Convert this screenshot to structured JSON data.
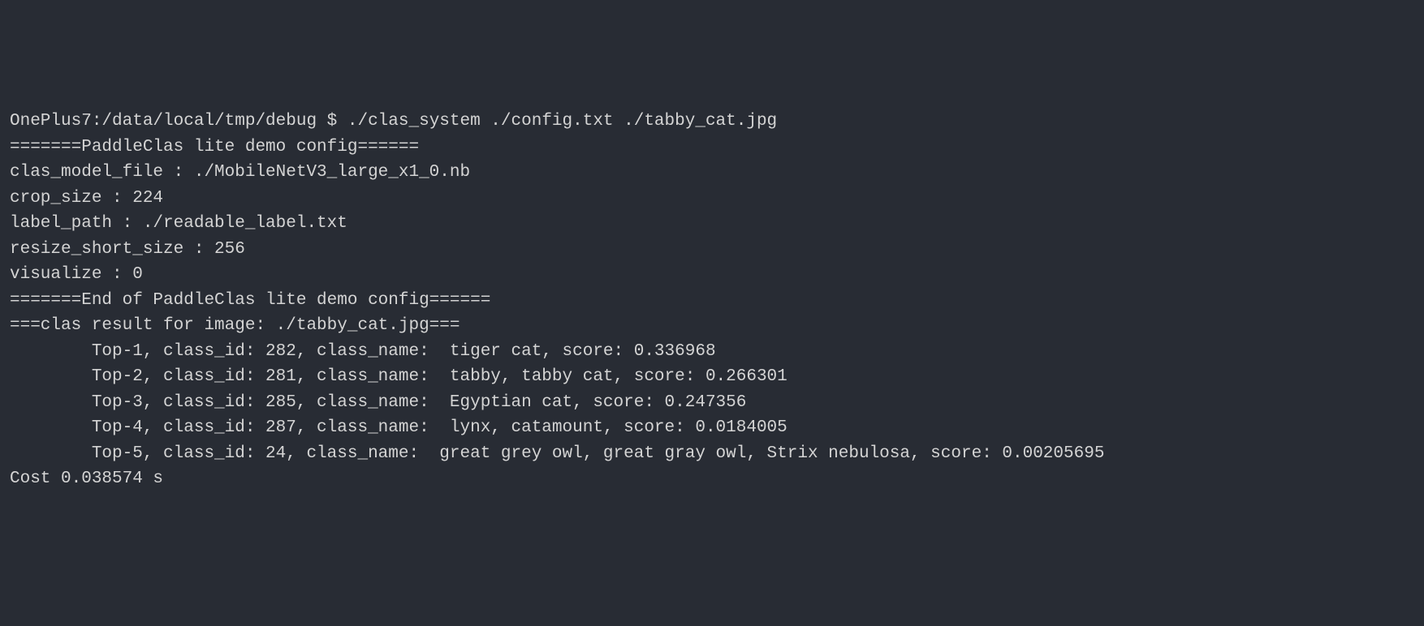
{
  "terminal": {
    "prompt": "OnePlus7:/data/local/tmp/debug $ ",
    "command": "./clas_system ./config.txt ./tabby_cat.jpg",
    "lines": [
      "=======PaddleClas lite demo config======",
      "clas_model_file : ./MobileNetV3_large_x1_0.nb",
      "crop_size : 224",
      "label_path : ./readable_label.txt",
      "resize_short_size : 256",
      "visualize : 0",
      "=======End of PaddleClas lite demo config======",
      "===clas result for image: ./tabby_cat.jpg===",
      "        Top-1, class_id: 282, class_name:  tiger cat, score: 0.336968",
      "        Top-2, class_id: 281, class_name:  tabby, tabby cat, score: 0.266301",
      "        Top-3, class_id: 285, class_name:  Egyptian cat, score: 0.247356",
      "        Top-4, class_id: 287, class_name:  lynx, catamount, score: 0.0184005",
      "        Top-5, class_id: 24, class_name:  great grey owl, great gray owl, Strix nebulosa, score: 0.00205695",
      "Cost 0.038574 s"
    ]
  }
}
